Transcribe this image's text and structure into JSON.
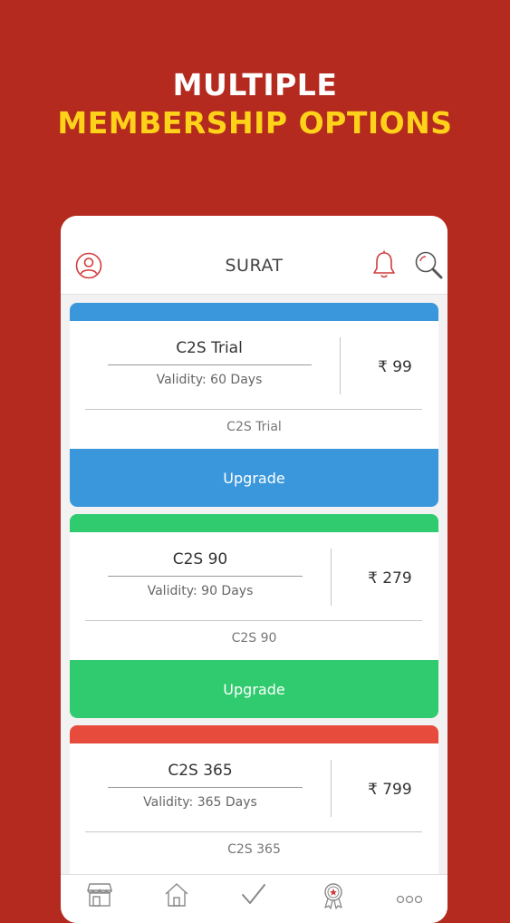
{
  "promo": {
    "line1": "MULTIPLE",
    "line2": "MEMBERSHIP OPTIONS"
  },
  "header": {
    "title": "SURAT",
    "icons": [
      "user-icon",
      "bell-icon",
      "search-icon"
    ]
  },
  "plans": [
    {
      "name": "C2S Trial",
      "validity": "Validity: 60 Days",
      "price": "₹ 99",
      "subtitle": "C2S Trial",
      "button": "Upgrade",
      "color": "#3a97dc"
    },
    {
      "name": "C2S 90",
      "validity": "Validity: 90 Days",
      "price": "₹ 279",
      "subtitle": "C2S 90",
      "button": "Upgrade",
      "color": "#2fcb6e"
    },
    {
      "name": "C2S 365",
      "validity": "Validity: 365 Days",
      "price": "₹ 799",
      "subtitle": "C2S 365",
      "color": "#e64b3c"
    }
  ],
  "bottom_nav": {
    "icons": [
      "store-icon",
      "home-icon",
      "check-icon",
      "award-icon",
      "more-icon"
    ]
  },
  "colors": {
    "background": "#b42a1f",
    "promo_highlight": "#ffd21a"
  }
}
